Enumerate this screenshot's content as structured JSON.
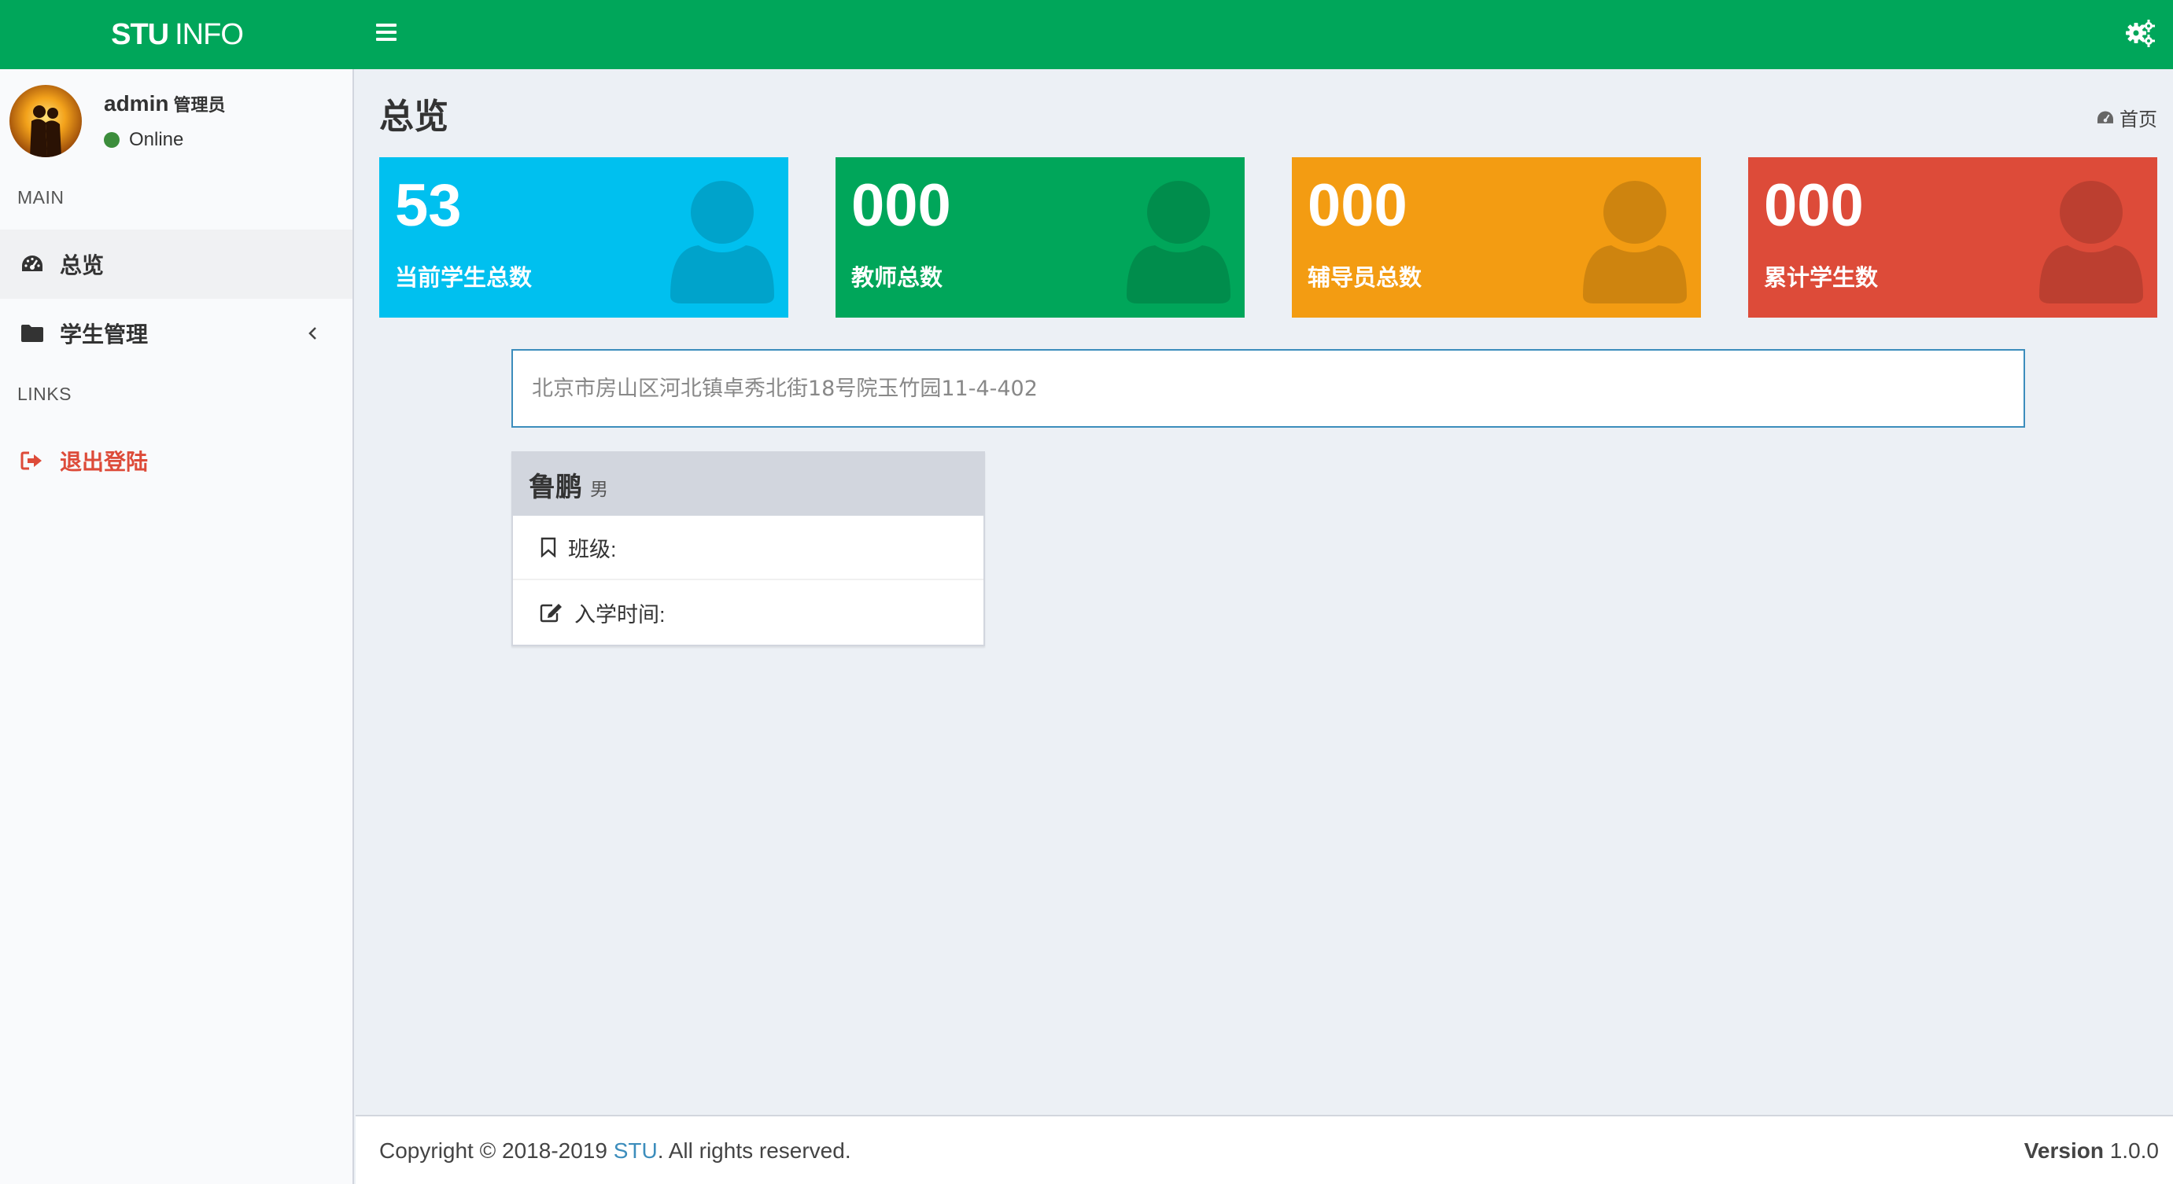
{
  "header": {
    "logo_bold": "STU",
    "logo_light": "INFO",
    "accent_color": "#00a65a"
  },
  "sidebar": {
    "user": {
      "name": "admin",
      "role": "管理员",
      "status": "Online"
    },
    "main_header": "MAIN",
    "links_header": "LINKS",
    "items": [
      {
        "label": "总览",
        "icon": "dashboard-icon"
      },
      {
        "label": "学生管理",
        "icon": "folder-icon"
      }
    ],
    "logout_label": "退出登陆"
  },
  "page": {
    "title": "总览",
    "breadcrumb_home": "首页"
  },
  "stats": [
    {
      "value": "53",
      "label": "当前学生总数",
      "color": "#00c0ef"
    },
    {
      "value": "000",
      "label": "教师总数",
      "color": "#00a65a"
    },
    {
      "value": "000",
      "label": "辅导员总数",
      "color": "#f39c12"
    },
    {
      "value": "000",
      "label": "累计学生数",
      "color": "#dd4b39"
    }
  ],
  "search": {
    "placeholder": "北京市房山区河北镇卓秀北街18号院玉竹园11-4-402"
  },
  "student": {
    "name": "鲁鹏",
    "gender": "男",
    "class_label": "班级:",
    "enroll_label": "入学时间:"
  },
  "footer": {
    "copyright_prefix": "Copyright © 2018-2019 ",
    "brand": "STU",
    "copyright_suffix": ". All rights reserved.",
    "version_label": "Version",
    "version_value": " 1.0.0"
  }
}
